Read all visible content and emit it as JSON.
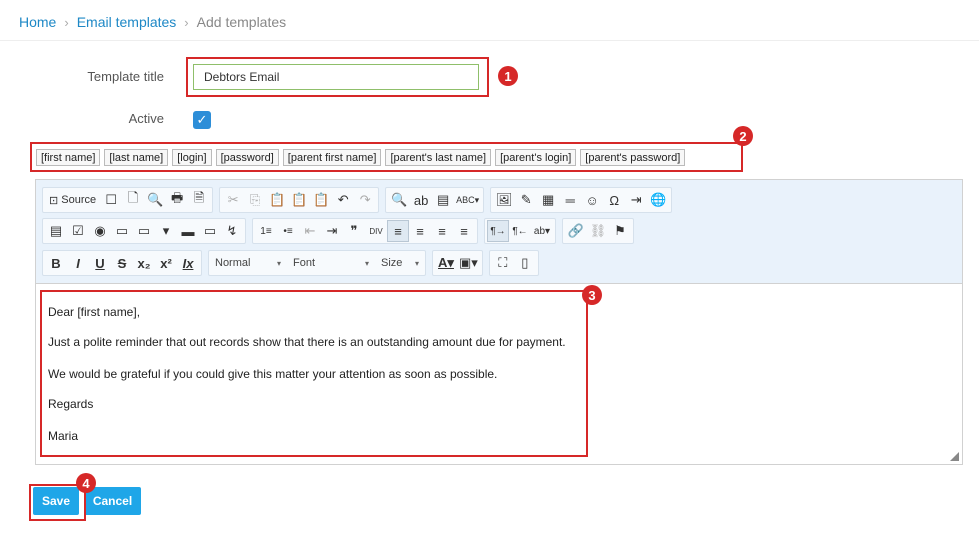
{
  "breadcrumb": {
    "home": "Home",
    "email_templates": "Email templates",
    "current": "Add templates",
    "sep": "›"
  },
  "form": {
    "title_label": "Template title",
    "title_value": "Debtors Email",
    "active_label": "Active",
    "active_checked": true,
    "check_glyph": "✓"
  },
  "placeholders": [
    "[first name]",
    "[last name]",
    "[login]",
    "[password]",
    "[parent first name]",
    "[parent's last name]",
    "[parent's login]",
    "[parent's password]"
  ],
  "toolbar": {
    "source_label": "Source",
    "format_label": "Normal",
    "font_label": "Font",
    "size_label": "Size",
    "dropdown_glyph": "▾",
    "row1": [
      [
        "Source-btn",
        "☐",
        "🗋",
        "🔍",
        "🖶",
        "🗎"
      ],
      [
        "✂",
        "⎘",
        "📋",
        "📋",
        "📋",
        "↶",
        "↷"
      ],
      [
        "🔍",
        "ab",
        "▤",
        "ABC▾"
      ],
      [
        "🖼",
        "✎",
        "▦",
        "═",
        "☺",
        "Ω",
        "⇥",
        "🌐"
      ]
    ],
    "row2": [
      [
        "▤",
        "☑",
        "◉",
        "▭",
        "▭",
        "▾",
        "▬",
        "▭",
        "↯"
      ],
      [
        "1≡",
        "•≡",
        "⇤",
        "⇥",
        "❞",
        "DIV",
        "≡",
        "≡",
        "≡",
        "≡"
      ],
      [
        "¶→",
        "¶←",
        "ab▾"
      ],
      [
        "🔗",
        "⛓",
        "⚑"
      ]
    ],
    "row3": [
      [
        "B",
        "I",
        "U",
        "S",
        "x₂",
        "x²",
        "Ix"
      ],
      [
        "A▾",
        "▣▾"
      ],
      [
        "⛶",
        "▯"
      ]
    ]
  },
  "body": [
    "Dear [first name],",
    "Just a polite reminder that out records show that there is an outstanding amount due for payment.",
    "We would be grateful if you could give this matter your attention as soon as possible.",
    "Regards",
    "Maria"
  ],
  "callouts": [
    "1",
    "2",
    "3",
    "4"
  ],
  "buttons": {
    "save": "Save",
    "cancel": "Cancel"
  },
  "colors": {
    "accent": "#1fa6e8",
    "link": "#1e88c6",
    "callout": "#d62828",
    "checkbox": "#2d8ed8"
  }
}
